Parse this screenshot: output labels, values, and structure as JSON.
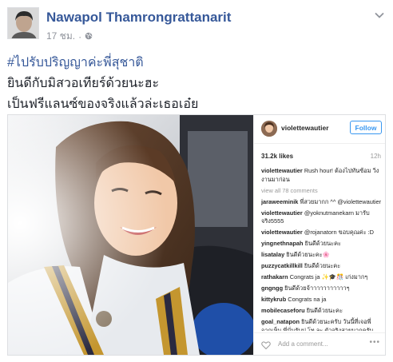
{
  "post": {
    "author": "Nawapol Thamrongrattanarit",
    "time": "17 ชม.",
    "separator": "·",
    "privacy_icon": "globe-icon",
    "text": {
      "hashtag": "#ไปรับปริญญาค่ะพี่สุชาติ",
      "line1": "ยินดีกับมิสวอเทียร์ด้วยนะฮะ",
      "line2": "เป็นฟรีแลนซ์ของจริงแล้วล่ะเธอเอ๋ย"
    }
  },
  "instagram": {
    "username": "violettewautier",
    "follow_label": "Follow",
    "likes": "31.2k likes",
    "time": "12h",
    "comments": [
      {
        "user": "violettewautier",
        "text": "Rush hour! ต้องไปทันซ้อม วิ่งงานมาก่อน"
      },
      {
        "user": "",
        "text": "view all 78 comments"
      },
      {
        "user": "jaraweeminik",
        "text": "พี่สวยมากก ^^ @violettewautier"
      },
      {
        "user": "violettewautier",
        "text": "@yoknutmanekarn มารับจริง5555"
      },
      {
        "user": "violettewautier",
        "text": "@rojanatorn ขอบคุณค่ะ :D"
      },
      {
        "user": "yingnethnapah",
        "text": "ยินดีด้วยนะคะ"
      },
      {
        "user": "lisatalay",
        "text": "ยินดีด้วยนะคะ🌸"
      },
      {
        "user": "puzzycatkillkill",
        "text": "ยินดีด้วยนะคะ"
      },
      {
        "user": "rathakarn",
        "text": "Congrats ja ✨🎓🎊 เก่งมากๆ"
      },
      {
        "user": "gngngg",
        "text": "ยินดีด้วยจ้าาาาาาาาาาาๆ"
      },
      {
        "user": "kittykrub",
        "text": "Congrats na ja"
      },
      {
        "user": "mobilecaseforu",
        "text": "ยินดีด้วยนะคะ"
      },
      {
        "user": "goal_natapon",
        "text": "ยินดีด้วยนะครับ วันนี้ที่เจอพี่ จากเห็น พี่นั่นรับป.โท ละ ตัวจริงสวยมากครับ"
      }
    ],
    "add_comment": "Add a comment...",
    "more_label": "•••"
  },
  "colors": {
    "link_blue": "#365899",
    "ig_blue": "#3897f0",
    "meta_gray": "#90949c"
  }
}
